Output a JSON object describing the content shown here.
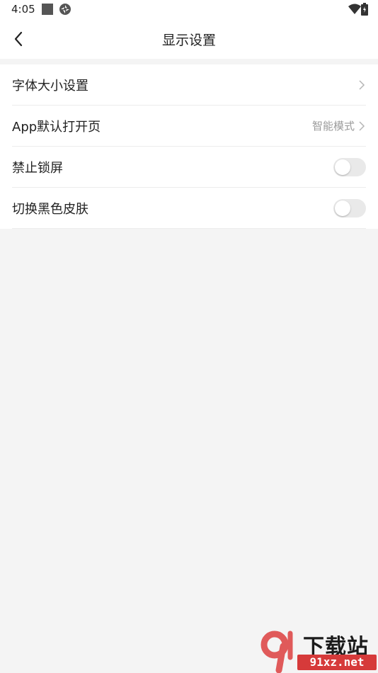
{
  "status_bar": {
    "time": "4:05"
  },
  "header": {
    "title": "显示设置"
  },
  "settings": [
    {
      "label": "字体大小设置",
      "value": "",
      "control": "chevron"
    },
    {
      "label": "App默认打开页",
      "value": "智能模式",
      "control": "chevron"
    },
    {
      "label": "禁止锁屏",
      "value": "",
      "control": "toggle",
      "on": false
    },
    {
      "label": "切换黑色皮肤",
      "value": "",
      "control": "toggle",
      "on": false
    }
  ],
  "watermark": {
    "text": "下载站",
    "url": "91xz.net"
  },
  "colors": {
    "accent_watermark": "#d63a3a",
    "background": "#f4f4f4"
  }
}
